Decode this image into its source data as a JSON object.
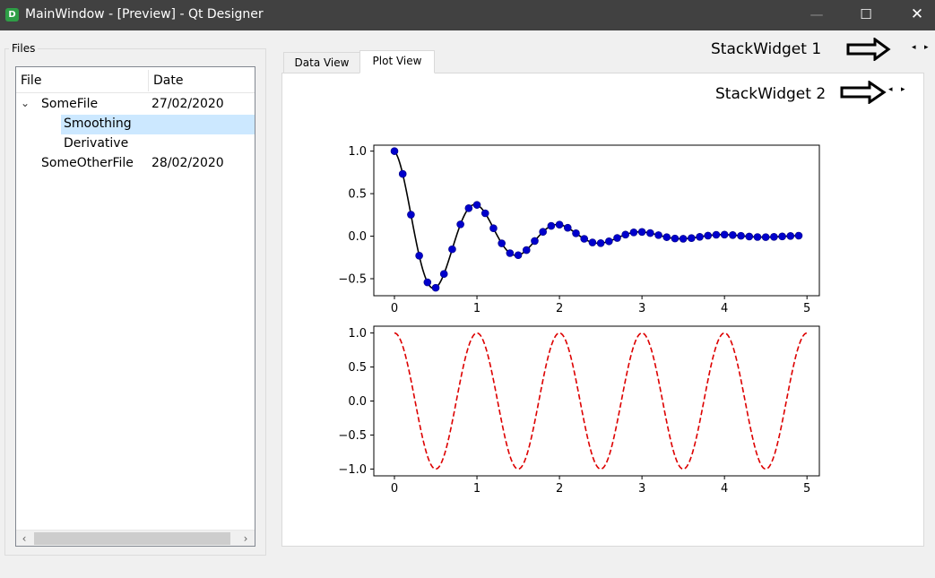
{
  "window": {
    "icon_letter": "D",
    "title": "MainWindow - [Preview] - Qt Designer",
    "minimize_glyph": "—",
    "maximize_glyph": "☐",
    "close_glyph": "✕"
  },
  "files": {
    "legend": "Files",
    "columns": [
      "File",
      "Date"
    ],
    "rows": [
      {
        "name": "SomeFile",
        "date": "27/02/2020",
        "expanded": true
      },
      {
        "name": "Smoothing",
        "date": "",
        "selected": true
      },
      {
        "name": "Derivative",
        "date": ""
      },
      {
        "name": "SomeOtherFile",
        "date": "28/02/2020"
      }
    ],
    "scroll_left": "‹",
    "scroll_right": "›"
  },
  "tabs": [
    {
      "label": "Data View",
      "active": false
    },
    {
      "label": "Plot View",
      "active": true
    }
  ],
  "stack": {
    "label1": "StackWidget 1",
    "label2": "StackWidget 2"
  },
  "chart_data": [
    {
      "type": "line",
      "series": [
        {
          "style": "black solid line with blue circle markers",
          "function": "exp(-x)*cos(2*pi*x)",
          "x_range": [
            0,
            4.9
          ],
          "step": 0.1
        }
      ],
      "xlim": [
        -0.25,
        5.15
      ],
      "ylim": [
        -0.7,
        1.07
      ],
      "xticks": [
        "0",
        "1",
        "2",
        "3",
        "4",
        "5"
      ],
      "yticks": [
        "1.0",
        "0.5",
        "0.0",
        "−0.5"
      ],
      "colors": {
        "line": "#000000",
        "marker": "#0000cc"
      }
    },
    {
      "type": "line",
      "series": [
        {
          "style": "red dashed line",
          "function": "cos(2*pi*x)",
          "x_range": [
            0,
            5
          ]
        }
      ],
      "xlim": [
        -0.25,
        5.15
      ],
      "ylim": [
        -1.1,
        1.1
      ],
      "xticks": [
        "0",
        "1",
        "2",
        "3",
        "4",
        "5"
      ],
      "yticks": [
        "1.0",
        "0.5",
        "0.0",
        "−0.5",
        "−1.0"
      ],
      "colors": {
        "line": "#dd0000"
      }
    }
  ]
}
